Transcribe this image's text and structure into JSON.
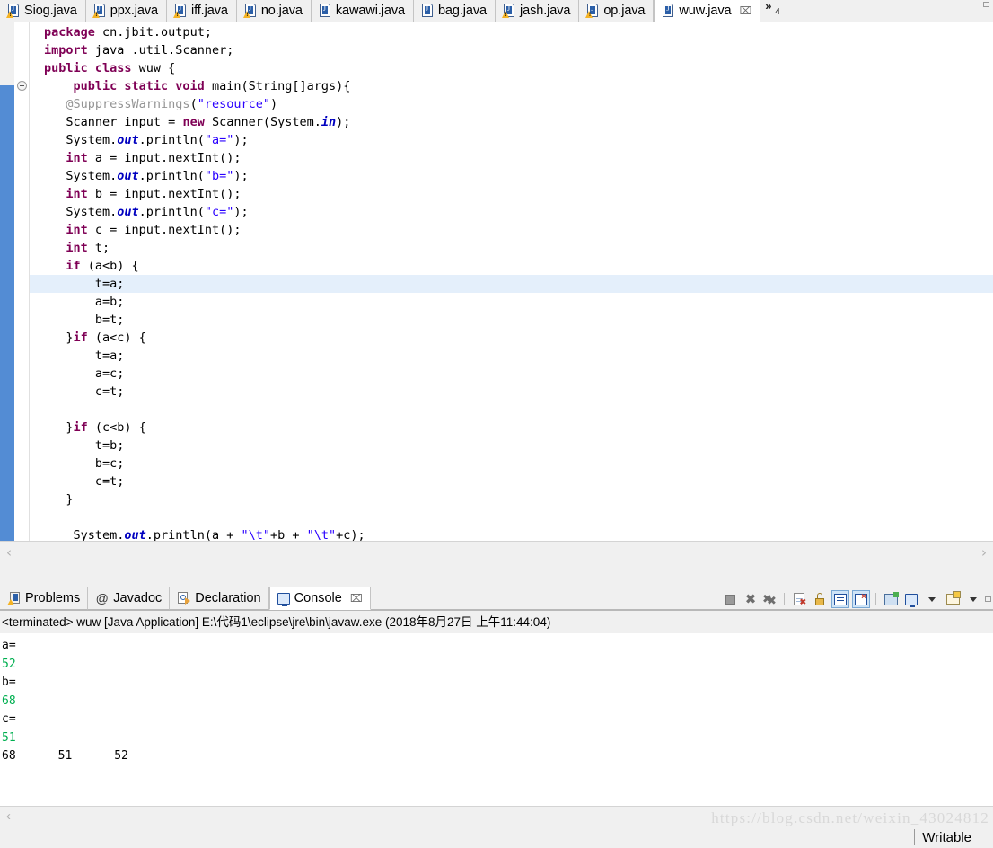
{
  "editor_tabs": [
    {
      "label": "Siog.java",
      "icon": "java-file-warning-icon",
      "active": false,
      "closable": false
    },
    {
      "label": "ppx.java",
      "icon": "java-file-warning-icon",
      "active": false,
      "closable": false
    },
    {
      "label": "iff.java",
      "icon": "java-file-warning-icon",
      "active": false,
      "closable": false
    },
    {
      "label": "no.java",
      "icon": "java-file-warning-icon",
      "active": false,
      "closable": false
    },
    {
      "label": "kawawi.java",
      "icon": "java-file-icon",
      "active": false,
      "closable": false
    },
    {
      "label": "bag.java",
      "icon": "java-file-icon",
      "active": false,
      "closable": false
    },
    {
      "label": "jash.java",
      "icon": "java-file-warning-icon",
      "active": false,
      "closable": false
    },
    {
      "label": "op.java",
      "icon": "java-file-warning-icon",
      "active": false,
      "closable": false
    },
    {
      "label": "wuw.java",
      "icon": "java-file-icon",
      "active": true,
      "closable": true
    }
  ],
  "tab_overflow": {
    "chevron": "»",
    "hidden_count": "4"
  },
  "tab_close_glyph": "⌧",
  "editor": {
    "highlighted_line_index": 14,
    "lines": [
      [
        {
          "t": "package ",
          "c": "kw"
        },
        {
          "t": "cn.jbit.output;",
          "c": "pln"
        }
      ],
      [
        {
          "t": "import ",
          "c": "kw"
        },
        {
          "t": "java .util.Scanner;",
          "c": "pln"
        }
      ],
      [
        {
          "t": "public class ",
          "c": "kw"
        },
        {
          "t": "wuw {",
          "c": "pln"
        }
      ],
      [
        {
          "t": "    ",
          "c": "pln"
        },
        {
          "t": "public static void ",
          "c": "kw"
        },
        {
          "t": "main(String[]args){",
          "c": "pln"
        }
      ],
      [
        {
          "t": "   ",
          "c": "pln"
        },
        {
          "t": "@SuppressWarnings",
          "c": "ann"
        },
        {
          "t": "(",
          "c": "pln"
        },
        {
          "t": "\"resource\"",
          "c": "str"
        },
        {
          "t": ")",
          "c": "pln"
        }
      ],
      [
        {
          "t": "   Scanner input = ",
          "c": "pln"
        },
        {
          "t": "new ",
          "c": "kw"
        },
        {
          "t": "Scanner(System.",
          "c": "pln"
        },
        {
          "t": "in",
          "c": "fld"
        },
        {
          "t": ");",
          "c": "pln"
        }
      ],
      [
        {
          "t": "   System.",
          "c": "pln"
        },
        {
          "t": "out",
          "c": "fld"
        },
        {
          "t": ".println(",
          "c": "pln"
        },
        {
          "t": "\"a=\"",
          "c": "str"
        },
        {
          "t": ");",
          "c": "pln"
        }
      ],
      [
        {
          "t": "   ",
          "c": "pln"
        },
        {
          "t": "int ",
          "c": "kw"
        },
        {
          "t": "a = input.nextInt();",
          "c": "pln"
        }
      ],
      [
        {
          "t": "   System.",
          "c": "pln"
        },
        {
          "t": "out",
          "c": "fld"
        },
        {
          "t": ".println(",
          "c": "pln"
        },
        {
          "t": "\"b=\"",
          "c": "str"
        },
        {
          "t": ");",
          "c": "pln"
        }
      ],
      [
        {
          "t": "   ",
          "c": "pln"
        },
        {
          "t": "int ",
          "c": "kw"
        },
        {
          "t": "b = input.nextInt();",
          "c": "pln"
        }
      ],
      [
        {
          "t": "   System.",
          "c": "pln"
        },
        {
          "t": "out",
          "c": "fld"
        },
        {
          "t": ".println(",
          "c": "pln"
        },
        {
          "t": "\"c=\"",
          "c": "str"
        },
        {
          "t": ");",
          "c": "pln"
        }
      ],
      [
        {
          "t": "   ",
          "c": "pln"
        },
        {
          "t": "int ",
          "c": "kw"
        },
        {
          "t": "c = input.nextInt();",
          "c": "pln"
        }
      ],
      [
        {
          "t": "   ",
          "c": "pln"
        },
        {
          "t": "int ",
          "c": "kw"
        },
        {
          "t": "t;",
          "c": "pln"
        }
      ],
      [
        {
          "t": "   ",
          "c": "pln"
        },
        {
          "t": "if ",
          "c": "kw"
        },
        {
          "t": "(a<b) {",
          "c": "pln"
        }
      ],
      [
        {
          "t": "       t=a;",
          "c": "pln"
        }
      ],
      [
        {
          "t": "       a=b;",
          "c": "pln"
        }
      ],
      [
        {
          "t": "       b=t;",
          "c": "pln"
        }
      ],
      [
        {
          "t": "   }",
          "c": "pln"
        },
        {
          "t": "if ",
          "c": "kw"
        },
        {
          "t": "(a<c) {",
          "c": "pln"
        }
      ],
      [
        {
          "t": "       t=a;",
          "c": "pln"
        }
      ],
      [
        {
          "t": "       a=c;",
          "c": "pln"
        }
      ],
      [
        {
          "t": "       c=t;",
          "c": "pln"
        }
      ],
      [
        {
          "t": "",
          "c": "pln"
        }
      ],
      [
        {
          "t": "   }",
          "c": "pln"
        },
        {
          "t": "if ",
          "c": "kw"
        },
        {
          "t": "(c<b) {",
          "c": "pln"
        }
      ],
      [
        {
          "t": "       t=b;",
          "c": "pln"
        }
      ],
      [
        {
          "t": "       b=c;",
          "c": "pln"
        }
      ],
      [
        {
          "t": "       c=t;",
          "c": "pln"
        }
      ],
      [
        {
          "t": "   }",
          "c": "pln"
        }
      ],
      [
        {
          "t": "",
          "c": "pln"
        }
      ],
      [
        {
          "t": "    System.",
          "c": "pln"
        },
        {
          "t": "out",
          "c": "fld"
        },
        {
          "t": ".println(a + ",
          "c": "pln"
        },
        {
          "t": "\"\\t\"",
          "c": "str"
        },
        {
          "t": "+b + ",
          "c": "pln"
        },
        {
          "t": "\"\\t\"",
          "c": "str"
        },
        {
          "t": "+c);",
          "c": "pln"
        }
      ]
    ],
    "scroll_left_arrow": "‹",
    "scroll_right_arrow": "›"
  },
  "view_tabs": [
    {
      "label": "Problems",
      "icon": "problems-icon",
      "active": false,
      "closable": false
    },
    {
      "label": "Javadoc",
      "icon": "at-sign-icon",
      "active": false,
      "closable": false
    },
    {
      "label": "Declaration",
      "icon": "declaration-icon",
      "active": false,
      "closable": false
    },
    {
      "label": "Console",
      "icon": "console-monitor-icon",
      "active": true,
      "closable": true
    }
  ],
  "console_toolbar": [
    {
      "name": "terminate-button",
      "tooltip": "Terminate",
      "pressed": false
    },
    {
      "name": "remove-launch-button",
      "tooltip": "Remove Launch",
      "pressed": false
    },
    {
      "name": "remove-all-terminated-button",
      "tooltip": "Remove All Terminated Launches",
      "pressed": false
    },
    {
      "name": "clear-console-button",
      "tooltip": "Clear Console",
      "pressed": false
    },
    {
      "name": "scroll-lock-button",
      "tooltip": "Scroll Lock",
      "pressed": false
    },
    {
      "name": "word-wrap-button",
      "tooltip": "Word Wrap",
      "pressed": true
    },
    {
      "name": "show-console-on-output-button",
      "tooltip": "Show Console When Standard Error Changes",
      "pressed": true
    },
    {
      "name": "pin-console-button",
      "tooltip": "Pin Console",
      "pressed": false
    },
    {
      "name": "display-selected-console-button",
      "tooltip": "Display Selected Console",
      "pressed": false
    },
    {
      "name": "open-console-button",
      "tooltip": "Open Console",
      "pressed": false
    }
  ],
  "console": {
    "title": "<terminated> wuw [Java Application] E:\\代码1\\eclipse\\jre\\bin\\javaw.exe (2018年8月27日 上午11:44:04)",
    "input_color": "#00af50",
    "output_color": "#000000",
    "lines": [
      {
        "text": "a=",
        "kind": "out"
      },
      {
        "text": "52",
        "kind": "inp"
      },
      {
        "text": "b=",
        "kind": "out"
      },
      {
        "text": "68",
        "kind": "inp"
      },
      {
        "text": "c=",
        "kind": "out"
      },
      {
        "text": "51",
        "kind": "inp"
      },
      {
        "text": "68\t51\t52",
        "kind": "out"
      }
    ],
    "scroll_left_arrow": "‹"
  },
  "statusbar": {
    "text": "Writable"
  },
  "watermark": {
    "text": "https://blog.csdn.net/weixin_43024812"
  },
  "colors": {
    "keyword": "#7f0055",
    "string": "#2a00ff",
    "annotation": "#949494",
    "field": "#0000c0",
    "current_line_highlight": "#e4effb",
    "chrome": "#f0f0f0",
    "fold_range": "#1464c8"
  }
}
